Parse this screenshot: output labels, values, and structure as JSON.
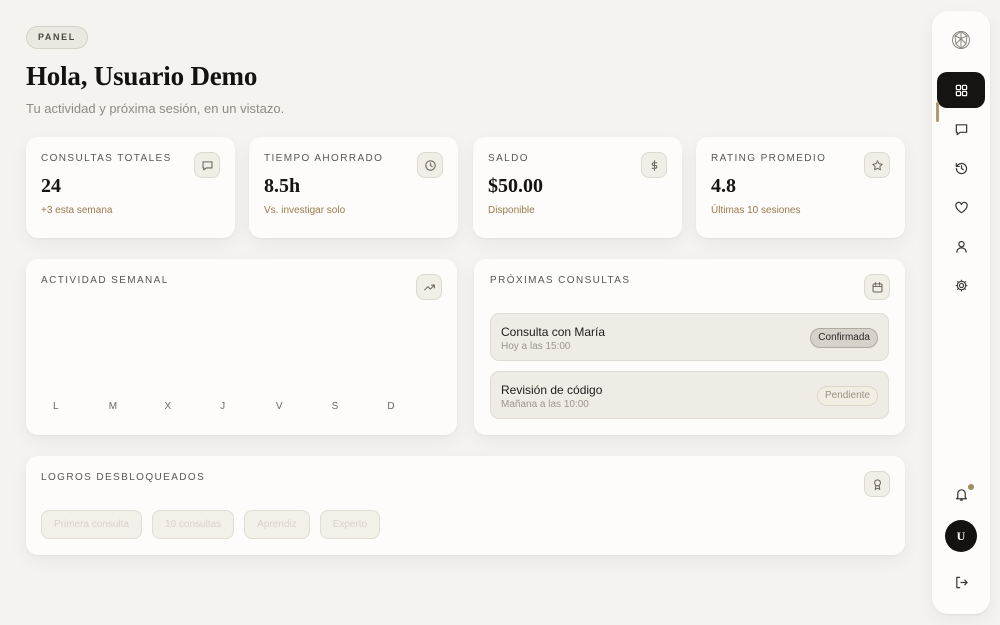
{
  "header": {
    "chip": "PANEL",
    "title": "Hola, Usuario Demo",
    "subtitle": "Tu actividad y próxima sesión, en un vistazo."
  },
  "stats": [
    {
      "label": "CONSULTAS TOTALES",
      "value": "24",
      "sub": "+3 esta semana",
      "icon": "chat-icon"
    },
    {
      "label": "TIEMPO AHORRADO",
      "value": "8.5h",
      "sub": "Vs. investigar solo",
      "icon": "clock-icon"
    },
    {
      "label": "SALDO",
      "value": "$50.00",
      "sub": "Disponible",
      "icon": "dollar-icon"
    },
    {
      "label": "RATING PROMEDIO",
      "value": "4.8",
      "sub": "Últimas 10 sesiones",
      "icon": "star-icon"
    }
  ],
  "weekly": {
    "label": "ACTIVIDAD SEMANAL",
    "days": [
      "L",
      "M",
      "X",
      "J",
      "V",
      "S",
      "D"
    ]
  },
  "upcoming": {
    "label": "PRÓXIMAS CONSULTAS",
    "items": [
      {
        "name": "Consulta con María",
        "time": "Hoy a las 15:00",
        "status": "Confirmada"
      },
      {
        "name": "Revisión de código",
        "time": "Mañana a las 10:00",
        "status": "Pendiente"
      }
    ]
  },
  "achievements": {
    "label": "LOGROS DESBLOQUEADOS",
    "items": [
      "Primera consulta",
      "10 consultas",
      "Aprendiz",
      "Experto"
    ]
  },
  "sidebar": {
    "avatar_initial": "U",
    "items": [
      "dashboard-icon",
      "chat-icon",
      "history-icon",
      "heart-icon",
      "user-icon",
      "gear-icon"
    ]
  },
  "colors": {
    "background": "#f4f3f0",
    "accent": "#9a7a4e",
    "active_nav": "#151412"
  }
}
